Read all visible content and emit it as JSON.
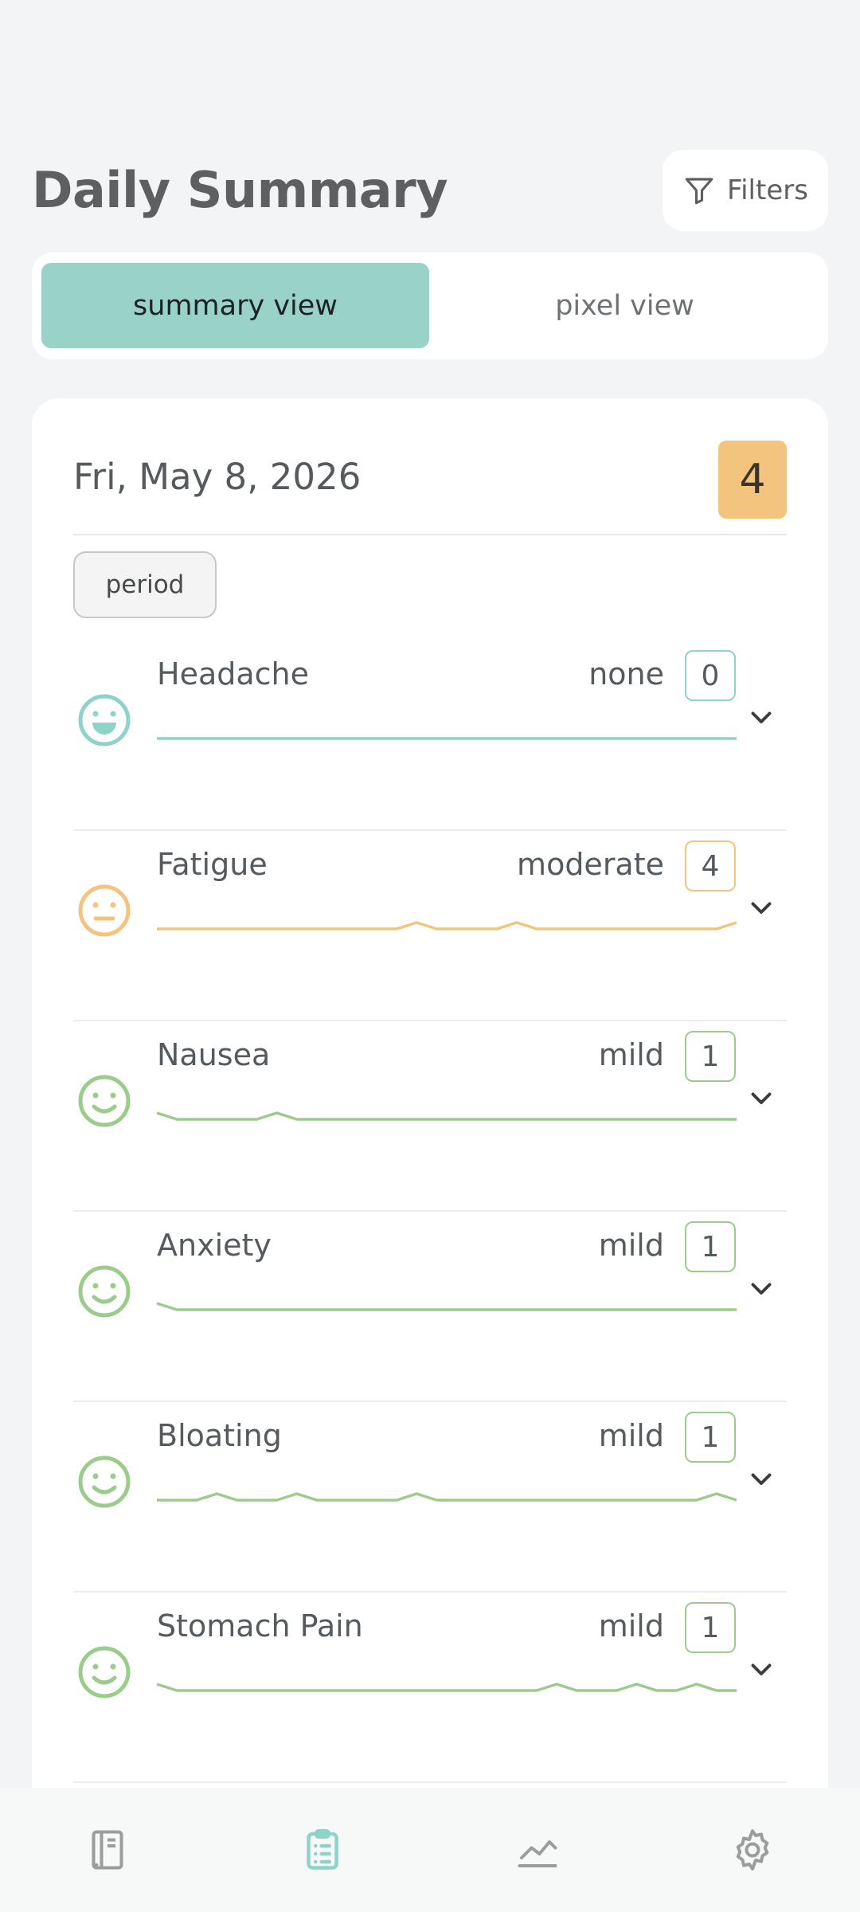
{
  "header": {
    "title": "Daily Summary",
    "filters_label": "Filters",
    "filters_icon": "filter-icon"
  },
  "view_toggle": {
    "tabs": [
      {
        "label": "summary view",
        "active": true
      },
      {
        "label": "pixel view",
        "active": false
      }
    ]
  },
  "day": {
    "date": "Fri, May 8, 2026",
    "score": "4",
    "score_color": "#f3c47e",
    "tags": [
      "period"
    ]
  },
  "colors": {
    "none": "#8fd3c8",
    "mild": "#9ccc8c",
    "moderate": "#f2c47e",
    "accent": "#99d3c8"
  },
  "symptoms": [
    {
      "name": "Headache",
      "level": "none",
      "value": "0",
      "face": "grin-face-icon",
      "color": "#8fd3c8",
      "trend": [
        0,
        0,
        0,
        0,
        0,
        0,
        0,
        0,
        0,
        0,
        0,
        0,
        0,
        0,
        0,
        0,
        0,
        0,
        0,
        0,
        0,
        0,
        0,
        0,
        0,
        0,
        0,
        0,
        0,
        0
      ]
    },
    {
      "name": "Fatigue",
      "level": "moderate",
      "value": "4",
      "face": "neutral-face-icon",
      "color": "#f2c47e",
      "trend": [
        0,
        0,
        0,
        0,
        0,
        0,
        0,
        0,
        0,
        0,
        0,
        0,
        0,
        1,
        0,
        0,
        0,
        0,
        1,
        0,
        0,
        0,
        0,
        0,
        0,
        0,
        0,
        0,
        0,
        1
      ]
    },
    {
      "name": "Nausea",
      "level": "mild",
      "value": "1",
      "face": "smile-face-icon",
      "color": "#9ccc8c",
      "trend": [
        1,
        0,
        0,
        0,
        0,
        0,
        1,
        0,
        0,
        0,
        0,
        0,
        0,
        0,
        0,
        0,
        0,
        0,
        0,
        0,
        0,
        0,
        0,
        0,
        0,
        0,
        0,
        0,
        0,
        0
      ]
    },
    {
      "name": "Anxiety",
      "level": "mild",
      "value": "1",
      "face": "smile-face-icon",
      "color": "#9ccc8c",
      "trend": [
        1,
        0,
        0,
        0,
        0,
        0,
        0,
        0,
        0,
        0,
        0,
        0,
        0,
        0,
        0,
        0,
        0,
        0,
        0,
        0,
        0,
        0,
        0,
        0,
        0,
        0,
        0,
        0,
        0,
        0
      ]
    },
    {
      "name": "Bloating",
      "level": "mild",
      "value": "1",
      "face": "smile-face-icon",
      "color": "#9ccc8c",
      "trend": [
        0,
        0,
        0,
        1,
        0,
        0,
        0,
        1,
        0,
        0,
        0,
        0,
        0,
        1,
        0,
        0,
        0,
        0,
        0,
        0,
        0,
        0,
        0,
        0,
        0,
        0,
        0,
        0,
        1,
        0
      ]
    },
    {
      "name": "Stomach Pain",
      "level": "mild",
      "value": "1",
      "face": "smile-face-icon",
      "color": "#9ccc8c",
      "trend": [
        1,
        0,
        0,
        0,
        0,
        0,
        0,
        0,
        0,
        0,
        0,
        0,
        0,
        0,
        0,
        0,
        0,
        0,
        0,
        0,
        1,
        0,
        0,
        0,
        1,
        0,
        0,
        1,
        0,
        0
      ]
    }
  ],
  "bottom_nav": [
    {
      "name": "journal",
      "icon": "journal-icon",
      "active": false
    },
    {
      "name": "summary",
      "icon": "clipboard-icon",
      "active": true
    },
    {
      "name": "trends",
      "icon": "chart-icon",
      "active": false
    },
    {
      "name": "settings",
      "icon": "gear-icon",
      "active": false
    }
  ]
}
